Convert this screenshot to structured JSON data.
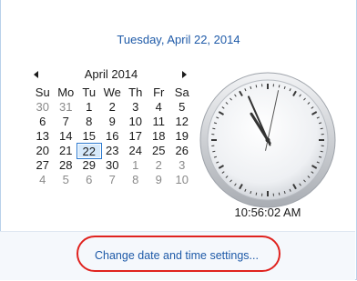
{
  "header": {
    "date_text": "Tuesday, April 22, 2014"
  },
  "calendar": {
    "month_title": "April 2014",
    "weekdays": [
      "Su",
      "Mo",
      "Tu",
      "We",
      "Th",
      "Fr",
      "Sa"
    ],
    "weeks": [
      [
        "30",
        "31",
        "1",
        "2",
        "3",
        "4",
        "5"
      ],
      [
        "6",
        "7",
        "8",
        "9",
        "10",
        "11",
        "12"
      ],
      [
        "13",
        "14",
        "15",
        "16",
        "17",
        "18",
        "19"
      ],
      [
        "20",
        "21",
        "22",
        "23",
        "24",
        "25",
        "26"
      ],
      [
        "27",
        "28",
        "29",
        "30",
        "1",
        "2",
        "3"
      ],
      [
        "4",
        "5",
        "6",
        "7",
        "8",
        "9",
        "10"
      ]
    ],
    "selected_day": "22",
    "prev_icon": "triangle-left-icon",
    "next_icon": "triangle-right-icon"
  },
  "clock": {
    "time_text": "10:56:02 AM",
    "hour": 10,
    "minute": 56,
    "second": 2
  },
  "footer": {
    "link_label": "Change date and time settings..."
  },
  "colors": {
    "accent": "#1e5aa8",
    "selection_border": "#2d7ad0",
    "selection_fill": "#d6e9fb",
    "annotation": "#e0231f",
    "muted": "#8a8a8a"
  }
}
